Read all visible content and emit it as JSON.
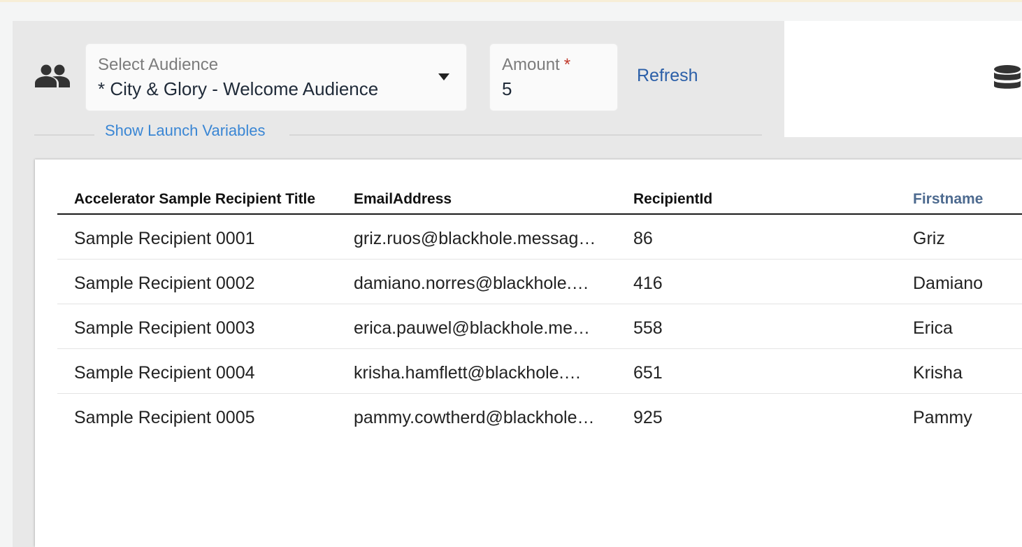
{
  "audience": {
    "label": "Select Audience",
    "value": "* City & Glory - Welcome Audience"
  },
  "amount": {
    "label": "Amount",
    "required_marker": "*",
    "value": "5"
  },
  "refresh_label": "Refresh",
  "launch_variables_label": "Show Launch Variables",
  "table": {
    "columns": [
      "Accelerator Sample Recipient Title",
      "EmailAddress",
      "RecipientId",
      "Firstname"
    ],
    "rows": [
      [
        "Sample Recipient 0001",
        "griz.ruos@blackhole.messag…",
        "86",
        "Griz"
      ],
      [
        "Sample Recipient 0002",
        "damiano.norres@blackhole.…",
        "416",
        "Damiano"
      ],
      [
        "Sample Recipient 0003",
        "erica.pauwel@blackhole.me…",
        "558",
        "Erica"
      ],
      [
        "Sample Recipient 0004",
        "krisha.hamflett@blackhole.…",
        "651",
        "Krisha"
      ],
      [
        "Sample Recipient 0005",
        "pammy.cowtherd@blackhole…",
        "925",
        "Pammy"
      ]
    ]
  },
  "icons": {
    "audience": "people-icon",
    "dropdown": "caret-down-icon",
    "database": "database-icon"
  },
  "colors": {
    "link": "#2b5fa8",
    "link_light": "#3a86d4",
    "required": "#c0392b",
    "sorted_header": "#4d6a8f"
  }
}
